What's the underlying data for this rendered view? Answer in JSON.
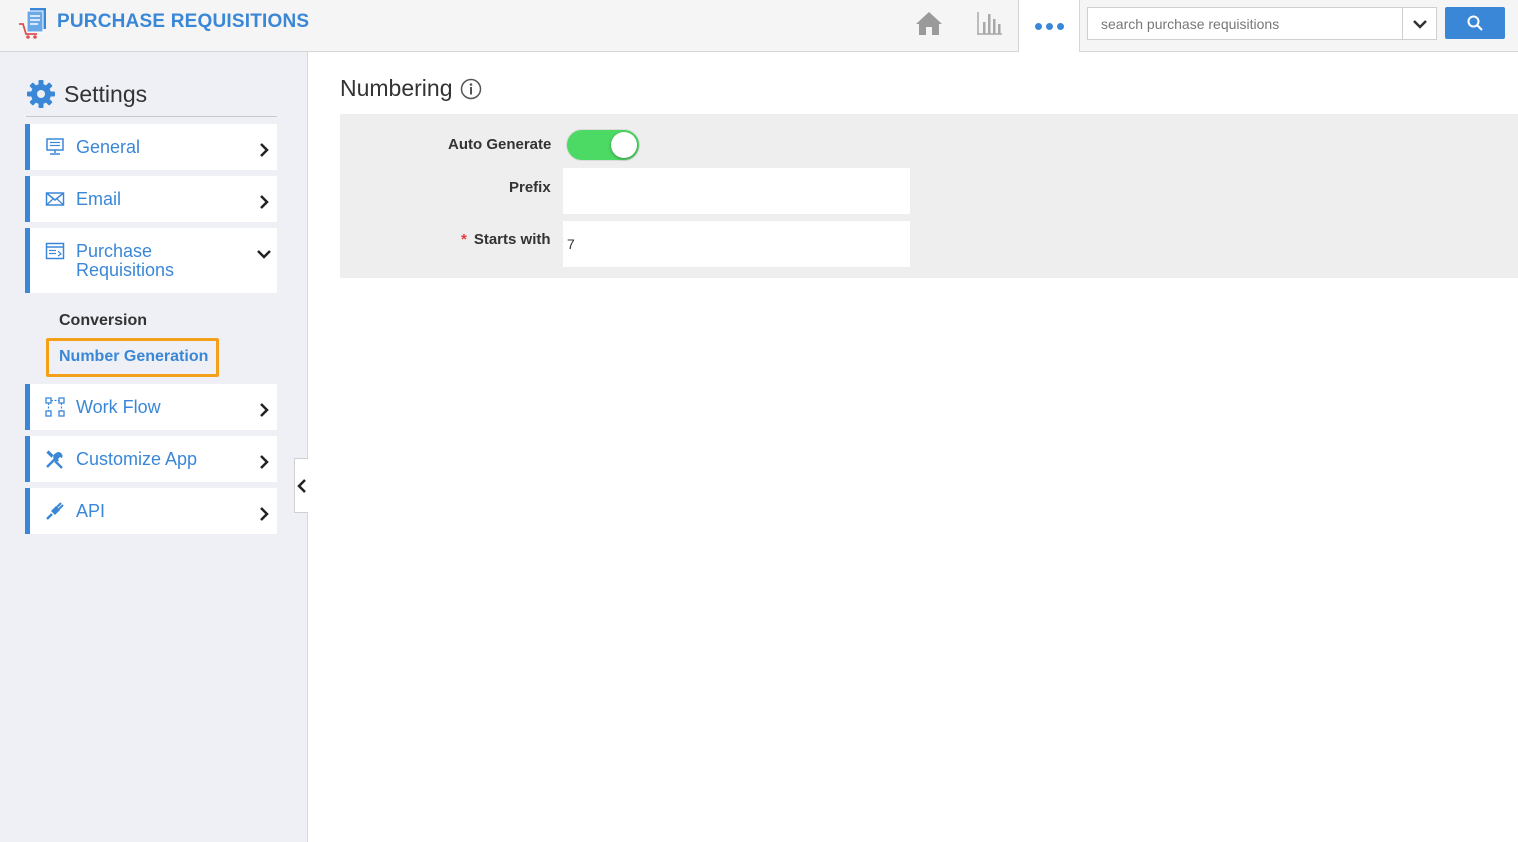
{
  "header": {
    "app_title": "PURCHASE REQUISITIONS",
    "icons": [
      "home-icon",
      "bar-chart-icon",
      "more-icon"
    ],
    "search": {
      "placeholder": "search purchase requisitions",
      "value": ""
    },
    "accent_color": "#3a87d8"
  },
  "sidebar": {
    "title": "Settings",
    "items": [
      {
        "label": "General",
        "icon": "monitor-icon",
        "expanded": false
      },
      {
        "label": "Email",
        "icon": "envelope-icon",
        "expanded": false
      },
      {
        "label": "Purchase Requisitions",
        "icon": "form-icon",
        "expanded": true,
        "subitems": [
          {
            "label": "Conversion",
            "active": false
          },
          {
            "label": "Number Generation",
            "active": true
          }
        ]
      },
      {
        "label": "Work Flow",
        "icon": "workflow-icon",
        "expanded": false
      },
      {
        "label": "Customize App",
        "icon": "tools-icon",
        "expanded": false
      },
      {
        "label": "API",
        "icon": "plug-icon",
        "expanded": false
      }
    ]
  },
  "main": {
    "title": "Numbering",
    "form": {
      "auto_generate": {
        "label": "Auto Generate",
        "value": true
      },
      "prefix": {
        "label": "Prefix",
        "value": ""
      },
      "starts_with": {
        "label": "Starts with",
        "value": "7",
        "required_mark": "*"
      }
    }
  }
}
